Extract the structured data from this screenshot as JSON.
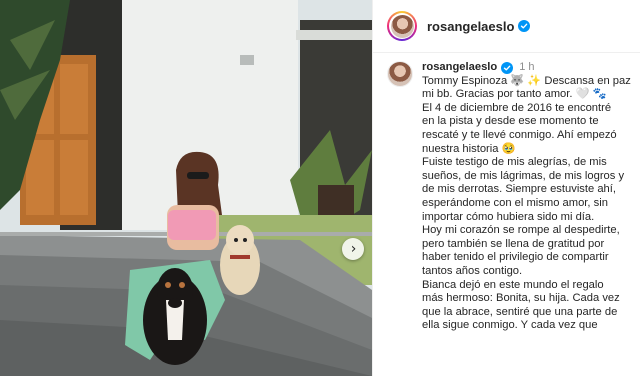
{
  "post": {
    "username": "rosangelaeslo",
    "verified": true,
    "time_ago": "1 h",
    "caption_lines": [
      "Tommy Espinoza 🐺 ✨ Descansa en paz",
      "mi bb. Gracias por tanto  amor. 🤍 🐾",
      "El 4 de diciembre de 2016 te encontré",
      "en la pista y desde ese momento te",
      "rescaté y te llevé conmigo. Ahí empezó",
      "nuestra historia 🥹",
      "Fuiste testigo de mis alegrías, de mis",
      "sueños, de mis lágrimas, de mis logros y",
      "de mis derrotas. Siempre estuviste ahí,",
      "esperándome con el mismo amor, sin",
      "importar cómo hubiera sido mi día.",
      "Hoy mi corazón se rompe al despedirte,",
      "pero también se llena de gratitud por",
      "haber tenido el privilegio de compartir",
      "tantos años contigo.",
      "Bianca dejó en este mundo el regalo",
      "más hermoso: Bonita, su hija. Cada vez",
      "que la abrace, sentiré que una parte de",
      "ella sigue conmigo. Y cada vez que"
    ]
  },
  "icons": {
    "verified": "verified-badge-icon",
    "next": "chevron-right-icon"
  },
  "colors": {
    "accent": "#0095f6",
    "text": "#262626",
    "muted": "#8e8e8e"
  }
}
